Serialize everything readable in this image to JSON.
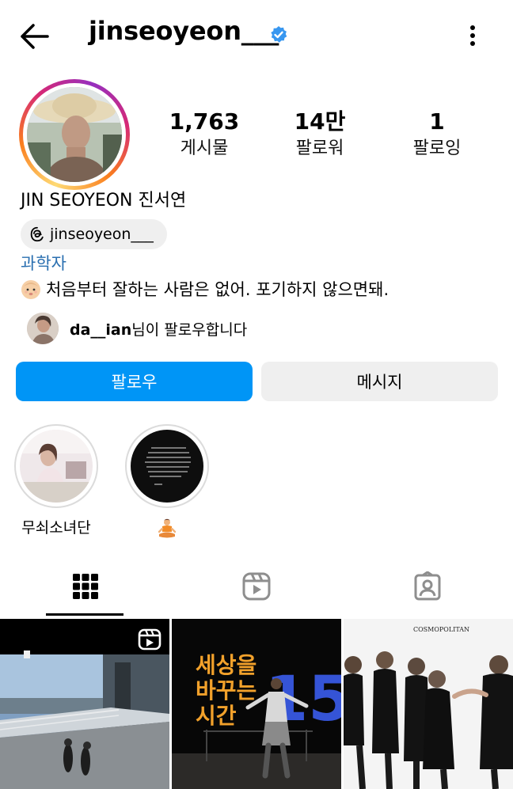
{
  "header": {
    "username": "jinseoyeon___",
    "back_icon": "back-arrow-icon",
    "verified_icon": "verified-badge-icon",
    "more_icon": "more-vertical-icon",
    "verified_color": "#3897f0"
  },
  "stats": [
    {
      "value": "1,763",
      "label": "게시물"
    },
    {
      "value": "14만",
      "label": "팔로워"
    },
    {
      "value": "1",
      "label": "팔로잉"
    }
  ],
  "profile": {
    "full_name": "JIN SEOYEON 진서연",
    "threads_handle": "jinseoyeon___",
    "category": "과학자",
    "bio": "처음부터 잘하는 사람은 없어. 포기하지 않으면돼."
  },
  "followed_by": {
    "username": "da__ian",
    "suffix": "님이 팔로우합니다"
  },
  "actions": {
    "follow_label": "팔로우",
    "message_label": "메시지",
    "follow_color": "#0095f6"
  },
  "highlights": [
    {
      "label": "무쇠소녀단"
    },
    {
      "label": ""
    }
  ],
  "tabs": [
    "grid-icon",
    "reels-icon",
    "tagged-icon"
  ],
  "posts": [
    {
      "type": "reel"
    },
    {
      "type": "image",
      "text_line1": "세상을",
      "text_line2": "바꾸는",
      "text_line3": "시간",
      "number": "15"
    },
    {
      "type": "image",
      "caption": "COSMOPOLITAN"
    }
  ]
}
